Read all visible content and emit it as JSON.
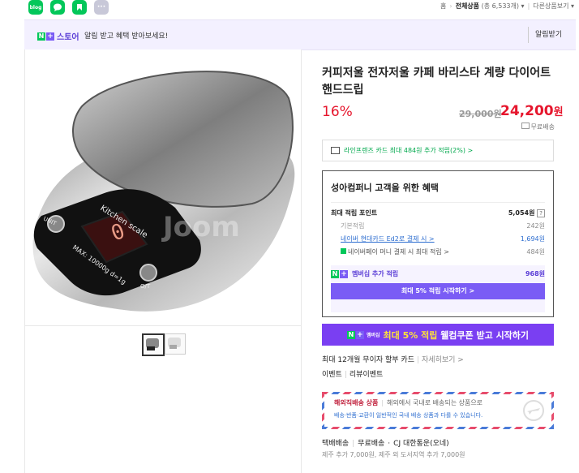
{
  "share": {
    "blog_label": "blog",
    "talk_label": "talk",
    "band_label": "band",
    "more_label": "···",
    "colors": {
      "blog": "#03c75a",
      "talk": "#03c75a",
      "band": "#03c75a",
      "more": "#c8c8d8"
    }
  },
  "breadcrumb": {
    "home": "홈",
    "category": "전체상품",
    "count": "(총 6,533개)",
    "other": "다른상품보기"
  },
  "store_banner": {
    "logo_n": "N",
    "logo_plus": "+",
    "logo_text": "스토어",
    "message": "알림 받고 혜택 받아보세요!",
    "button": "알림받기"
  },
  "product": {
    "title": "커피저울 전자저울 카페 바리스타 계량 다이어트 핸드드립",
    "discount": "16%",
    "original_price": "29,000원",
    "price": "24,200",
    "price_unit": "원",
    "shipping": "무료배송",
    "card_benefit": "라인프렌즈 카드 최대 484원 추가 적립(2%) >",
    "image": {
      "label_top": "Kitchen scale",
      "label_max": "MAX: 10000g  d=1g",
      "display": "0",
      "btn_left": "UNIT",
      "btn_right": "O/T",
      "watermark": "Joom"
    }
  },
  "benefit": {
    "header": "성아컴퍼니 고객을 위한 혜택",
    "max_points_label": "최대 적립 포인트",
    "max_points": "5,054원",
    "help": "?",
    "rows": [
      {
        "label": "기본적립",
        "value": "242원"
      },
      {
        "label": "네이버 현대카드 Ed2로 결제 시 >",
        "value": "1,694원"
      },
      {
        "label": "네이버페이 머니 결제 시 최대 적립 >",
        "value": "484원"
      }
    ],
    "member_label": "멤버십 추가 적립",
    "member_value": "968원",
    "member_button": "최대 5% 적립 시작하기 >"
  },
  "join_bar": {
    "badge": "멤버십",
    "highlight": "최대 5% 적립",
    "text": "웰컴쿠폰 받고 시작하기"
  },
  "installment": {
    "text": "최대 12개월 무이자 할부 카드",
    "link": "자세히보기 >"
  },
  "events": {
    "a": "이벤트",
    "b": "리뷰이벤트"
  },
  "overseas": {
    "label": "해외직배송 상품",
    "line1": "해외에서 국내로 배송되는 상품으로",
    "line2": "배송·반품·교환이 일반적인 국내 배송 상품과 다를 수 있습니다."
  },
  "delivery": {
    "type": "택배배송",
    "fee": "무료배송",
    "carrier": "CJ 대한통운(오네)",
    "extra": "제주 추가 7,000원, 제주 외 도서지역 추가 7,000원"
  }
}
